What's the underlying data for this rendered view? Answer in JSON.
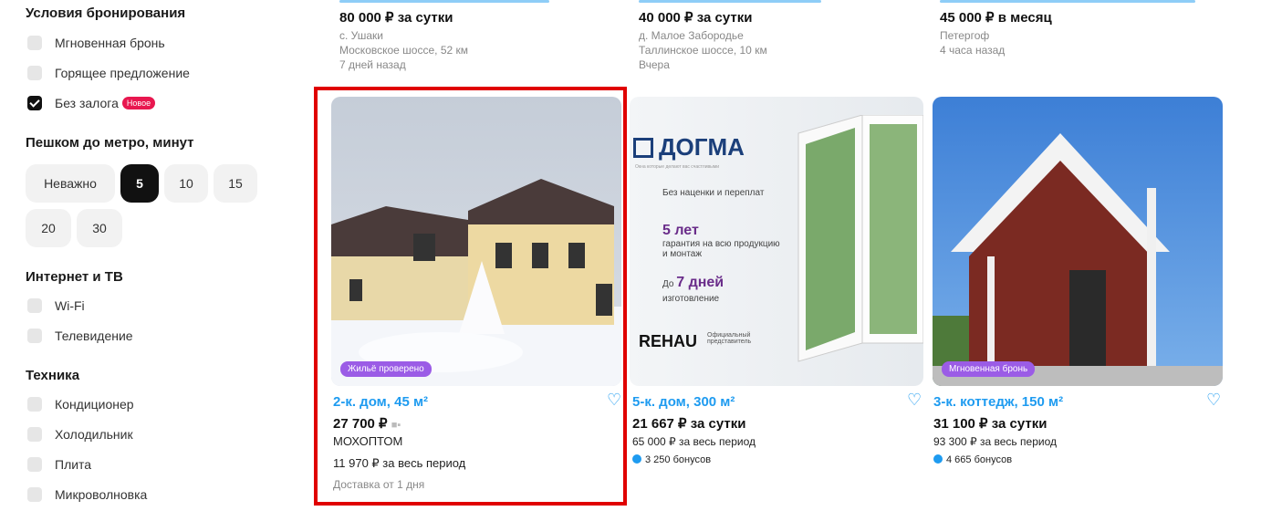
{
  "filters": {
    "booking": {
      "title": "Условия бронирования",
      "options": [
        {
          "label": "Мгновенная бронь",
          "checked": false
        },
        {
          "label": "Горящее предложение",
          "checked": false
        },
        {
          "label": "Без залога",
          "checked": true,
          "badge": "Новое"
        }
      ]
    },
    "metro": {
      "title": "Пешком до метро, минут",
      "chips": [
        "Неважно",
        "5",
        "10",
        "15",
        "20",
        "30"
      ],
      "selected": "5"
    },
    "internet": {
      "title": "Интернет и ТВ",
      "options": [
        {
          "label": "Wi-Fi",
          "checked": false
        },
        {
          "label": "Телевидение",
          "checked": false
        }
      ]
    },
    "appliances": {
      "title": "Техника",
      "options": [
        {
          "label": "Кондиционер",
          "checked": false
        },
        {
          "label": "Холодильник",
          "checked": false
        },
        {
          "label": "Плита",
          "checked": false
        },
        {
          "label": "Микроволновка",
          "checked": false
        }
      ]
    }
  },
  "top_cards": [
    {
      "price": "80 000 ₽ за сутки",
      "lines": [
        "с. Ушаки",
        "Московское шоссе, 52 км",
        "7 дней назад"
      ]
    },
    {
      "price": "40 000 ₽ за сутки",
      "lines": [
        "д. Малое Забородье",
        "Таллинское шоссе, 10 км",
        "Вчера"
      ]
    },
    {
      "price": "45 000 ₽ в месяц",
      "lines": [
        "Петергоф",
        "4 часа назад"
      ]
    }
  ],
  "cards": [
    {
      "title": "2-к. дом, 45 м²",
      "price": "27 700 ₽",
      "seller": "МОХОПТОМ",
      "total": "11 970 ₽ за весь период",
      "delivery": "Доставка от 1 дня",
      "sticker": "Жильё проверено"
    },
    {
      "title": "5-к. дом, 300 м²",
      "price": "21 667 ₽ за сутки",
      "total": "65 000 ₽ за весь период",
      "bonus": "3 250 бонусов",
      "ad": {
        "brand": "ДОГМА",
        "tagline": "Окна которые делают вас счастливыми",
        "item1": "Без наценки и переплат",
        "item2_big": "5 лет",
        "item2": "гарантия на всю продукцию и монтаж",
        "item3_pre": "До",
        "item3_big": "7 дней",
        "item3": "изготовление",
        "partner": "REHAU",
        "partner_note": "Официальный представитель"
      }
    },
    {
      "title": "3-к. коттедж, 150 м²",
      "price": "31 100 ₽ за сутки",
      "total": "93 300 ₽ за весь период",
      "bonus": "4 665 бонусов",
      "sticker": "Мгновенная бронь"
    }
  ]
}
